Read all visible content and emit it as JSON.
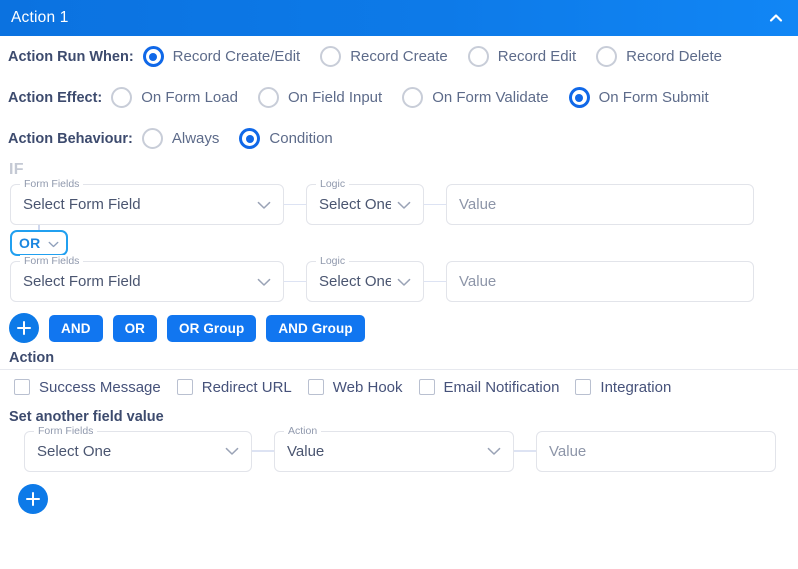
{
  "header": {
    "title": "Action 1",
    "collapse_icon": "chevron-up-icon"
  },
  "run_when": {
    "label": "Action Run When:",
    "options": [
      {
        "label": "Record Create/Edit",
        "selected": true
      },
      {
        "label": "Record Create",
        "selected": false
      },
      {
        "label": "Record Edit",
        "selected": false
      },
      {
        "label": "Record Delete",
        "selected": false
      }
    ]
  },
  "effect": {
    "label": "Action Effect:",
    "options": [
      {
        "label": "On Form Load",
        "selected": false
      },
      {
        "label": "On Field Input",
        "selected": false
      },
      {
        "label": "On Form Validate",
        "selected": false
      },
      {
        "label": "On Form Submit",
        "selected": true
      }
    ]
  },
  "behaviour": {
    "label": "Action Behaviour:",
    "options": [
      {
        "label": "Always",
        "selected": false
      },
      {
        "label": "Condition",
        "selected": true
      }
    ]
  },
  "condition": {
    "if_label": "IF",
    "rows": [
      {
        "form_field": {
          "legend": "Form Fields",
          "value": "Select Form Field"
        },
        "logic": {
          "legend": "Logic",
          "value": "Select One"
        },
        "value": {
          "legend": "",
          "placeholder": "Value"
        }
      },
      {
        "form_field": {
          "legend": "Form Fields",
          "value": "Select Form Field"
        },
        "logic": {
          "legend": "Logic",
          "value": "Select One"
        },
        "value": {
          "legend": "",
          "placeholder": "Value"
        }
      }
    ],
    "operator_pill": {
      "label": "OR",
      "icon": "chevron-down-icon"
    },
    "buttons": {
      "add": "+",
      "and": "AND",
      "or": "OR",
      "or_group": "OR Group",
      "and_group": "AND Group"
    }
  },
  "action_section": {
    "title": "Action",
    "checkboxes": [
      {
        "label": "Success Message",
        "checked": false
      },
      {
        "label": "Redirect URL",
        "checked": false
      },
      {
        "label": "Web Hook",
        "checked": false
      },
      {
        "label": "Email Notification",
        "checked": false
      },
      {
        "label": "Integration",
        "checked": false
      }
    ],
    "set_field_title": "Set another field value",
    "set_row": {
      "form_field": {
        "legend": "Form Fields",
        "value": "Select One"
      },
      "action": {
        "legend": "Action",
        "value": "Value"
      },
      "value": {
        "legend": "",
        "placeholder": "Value"
      }
    },
    "add_button": "+"
  },
  "colors": {
    "header_blue": "#0d7ae8",
    "accent_blue": "#1176f0",
    "pill_border": "#21a0f0",
    "text": "#3d4b6e",
    "muted": "#8d95a8",
    "connector": "#dde3f3"
  }
}
